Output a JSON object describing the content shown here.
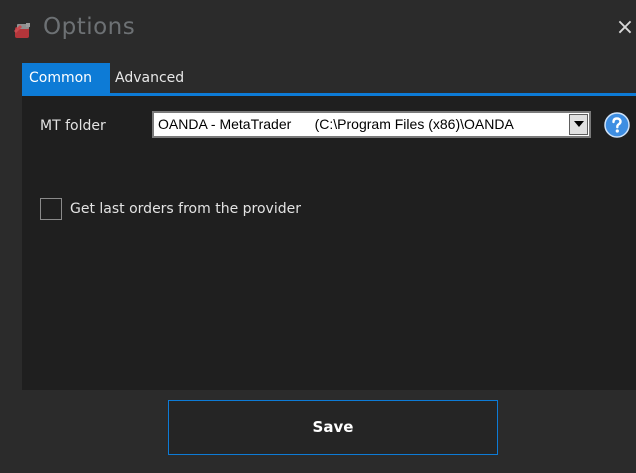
{
  "window": {
    "title": "Options",
    "close_symbol": "×",
    "app_icon": "options-app-icon"
  },
  "tabs": [
    {
      "label": "Common",
      "active": true
    },
    {
      "label": "Advanced",
      "active": false
    }
  ],
  "common": {
    "mt_folder_label": "MT folder",
    "mt_folder_value": "OANDA - MetaTrader      (C:\\Program Files (x86)\\OANDA",
    "help_icon": "question-circle-icon",
    "get_last_orders_label": "Get last orders from the provider",
    "get_last_orders_checked": false
  },
  "footer": {
    "save_label": "Save"
  },
  "colors": {
    "accent": "#0d7bd6",
    "background": "#2b2b2b",
    "panel": "#1f1f1f"
  }
}
